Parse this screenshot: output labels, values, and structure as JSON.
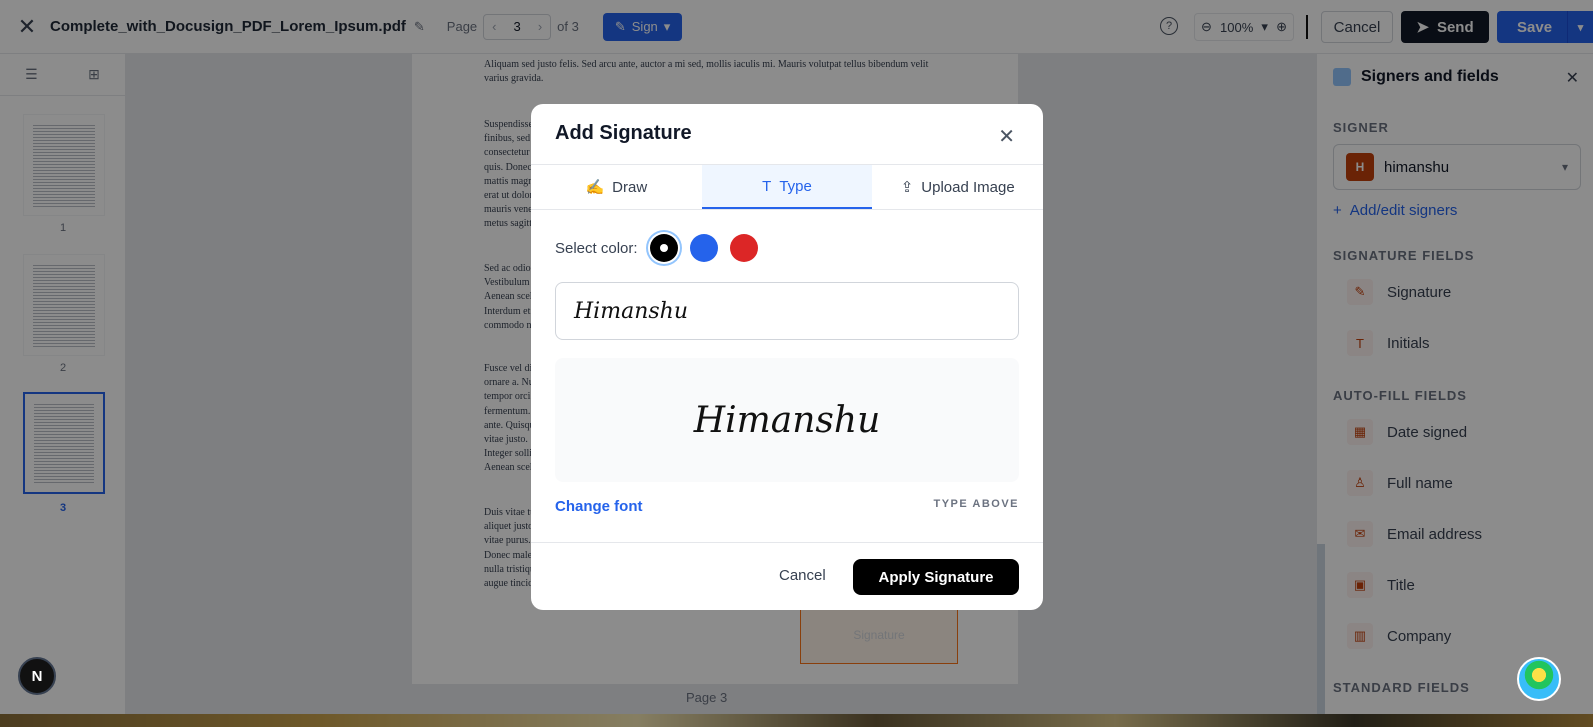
{
  "topbar": {
    "doc_title": "Complete_with_Docusign_PDF_Lorem_Ipsum.pdf",
    "page_label": "Page",
    "page_current": "3",
    "page_of": "of 3",
    "sign_label": "Sign",
    "zoom": "100%",
    "cancel_label": "Cancel",
    "send_label": "Send",
    "save_label": "Save"
  },
  "thumbnails": [
    {
      "label": "1"
    },
    {
      "label": "2"
    },
    {
      "label": "3"
    }
  ],
  "document": {
    "paragraphs": [
      "Aliquam sed justo felis. Sed arcu ante, auctor a mi sed, mollis iaculis mi. Mauris volutpat tellus bibendum velit varius gravida.",
      "Suspendisse finibus, sed c consectetur quis. Donec mattis magn erat ut dolor mauris vene metus sagitti",
      "Sed ac odio v Vestibulum a Aenean scele Interdum et commodo ni",
      "Fusce vel dig ornare a. Nul tempor orci. fermentum. ante. Quisqu vitae justo. S Integer sollic Aenean scele",
      "Duis vitae tu aliquet justo vitae purus. Donec males nulla tristiqu augue tincid"
    ],
    "signature_field_label": "Signature",
    "page_footer": "Page 3"
  },
  "right_panel": {
    "title": "Signers and fields",
    "signer_section": "SIGNER",
    "signer_initial": "H",
    "signer_name": "himanshu",
    "add_edit_signers": "Add/edit signers",
    "signature_fields_section": "SIGNATURE FIELDS",
    "signature_fields": [
      {
        "label": "Signature",
        "icon": "pen-icon"
      },
      {
        "label": "Initials",
        "icon": "text-icon"
      }
    ],
    "auto_fill_section": "AUTO-FILL FIELDS",
    "auto_fill_fields": [
      {
        "label": "Date signed",
        "icon": "calendar-icon"
      },
      {
        "label": "Full name",
        "icon": "person-icon"
      },
      {
        "label": "Email address",
        "icon": "mail-icon"
      },
      {
        "label": "Title",
        "icon": "briefcase-icon"
      },
      {
        "label": "Company",
        "icon": "building-icon"
      }
    ],
    "standard_section": "STANDARD FIELDS"
  },
  "modal": {
    "title": "Add Signature",
    "tabs": [
      {
        "label": "Draw",
        "active": false
      },
      {
        "label": "Type",
        "active": true
      },
      {
        "label": "Upload Image",
        "active": false
      }
    ],
    "select_color_label": "Select color:",
    "colors": [
      "#000000",
      "#2563eb",
      "#dc2626"
    ],
    "typed_value": "Himanshu",
    "preview_text": "Himanshu",
    "change_font_label": "Change font",
    "type_above_label": "TYPE ABOVE",
    "cancel_label": "Cancel",
    "apply_label": "Apply Signature"
  },
  "floating": {
    "n_badge": "N"
  }
}
